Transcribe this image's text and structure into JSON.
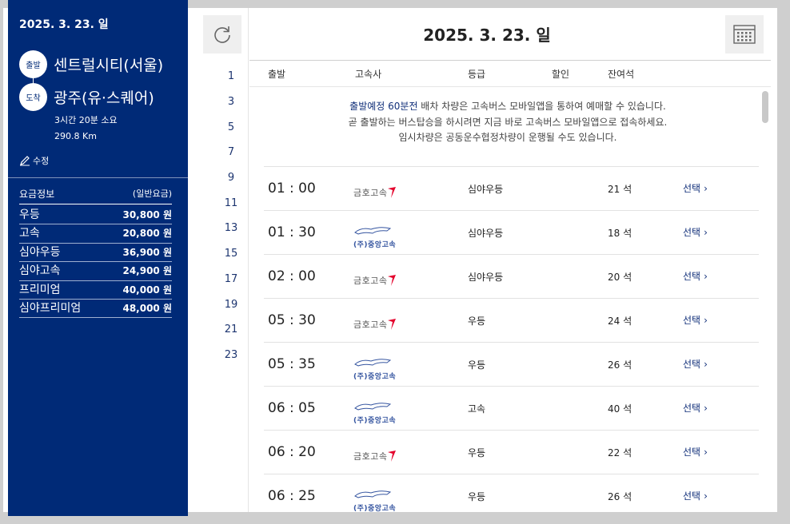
{
  "sidebar": {
    "date": "2025. 3. 23. 일",
    "departure_badge": "출발",
    "departure_name": "센트럴시티(서울)",
    "arrival_badge": "도착",
    "arrival_name": "광주(유·스퀘어)",
    "duration": "3시간 20분 소요",
    "distance": "290.8 Km",
    "edit_label": "수정",
    "fare_title": "요금정보",
    "fare_note": "(일반요금)",
    "fares": [
      {
        "grade": "우등",
        "price": "30,800 원"
      },
      {
        "grade": "고속",
        "price": "20,800 원"
      },
      {
        "grade": "심야우등",
        "price": "36,900 원"
      },
      {
        "grade": "심야고속",
        "price": "24,900 원"
      },
      {
        "grade": "프리미엄",
        "price": "40,000 원"
      },
      {
        "grade": "심야프리미엄",
        "price": "48,000 원"
      }
    ]
  },
  "header": {
    "title": "2025. 3. 23. 일",
    "refresh_icon": "refresh-icon",
    "calendar_icon": "calendar-icon"
  },
  "hours": [
    "1",
    "3",
    "5",
    "7",
    "9",
    "11",
    "13",
    "15",
    "17",
    "19",
    "21",
    "23"
  ],
  "table": {
    "columns": {
      "departure": "출발",
      "company": "고속사",
      "grade": "등급",
      "discount": "할인",
      "seats": "잔여석"
    },
    "notice": {
      "line1_highlight": "출발예정 60분전",
      "line1_rest": " 배차 차량은 고속버스 모바일앱을 통하여 예매할 수 있습니다.",
      "line2": "곧 출발하는 버스탑승을 하시려면 지금 바로 고속버스 모바일앱으로 접속하세요.",
      "line3": "임시차량은 공동운수협정차량이 운행될 수도 있습니다."
    },
    "rows": [
      {
        "time": "01 : 00",
        "company": "금호고속",
        "grade": "심야우등",
        "seats": "21 석",
        "select": "선택"
      },
      {
        "time": "01 : 30",
        "company": "(주)중앙고속",
        "grade": "심야우등",
        "seats": "18 석",
        "select": "선택"
      },
      {
        "time": "02 : 00",
        "company": "금호고속",
        "grade": "심야우등",
        "seats": "20 석",
        "select": "선택"
      },
      {
        "time": "05 : 30",
        "company": "금호고속",
        "grade": "우등",
        "seats": "24 석",
        "select": "선택"
      },
      {
        "time": "05 : 35",
        "company": "(주)중앙고속",
        "grade": "우등",
        "seats": "26 석",
        "select": "선택"
      },
      {
        "time": "06 : 05",
        "company": "(주)중앙고속",
        "grade": "고속",
        "seats": "40 석",
        "select": "선택"
      },
      {
        "time": "06 : 20",
        "company": "금호고속",
        "grade": "우등",
        "seats": "22 석",
        "select": "선택"
      },
      {
        "time": "06 : 25",
        "company": "(주)중앙고속",
        "grade": "우등",
        "seats": "26 석",
        "select": "선택"
      }
    ]
  },
  "colors": {
    "sidebar_bg": "#002a77",
    "accent": "#12307a",
    "kumho_red": "#e4002b"
  }
}
